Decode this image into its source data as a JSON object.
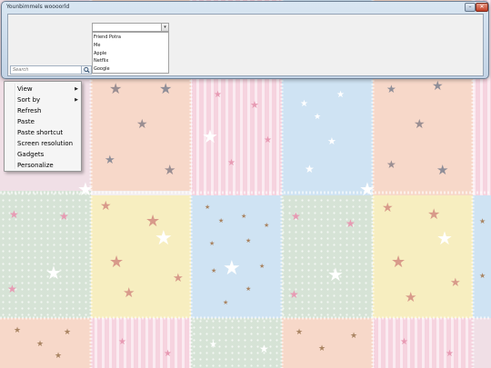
{
  "window": {
    "title": "Younbimmels woooorld",
    "minimize_glyph": "–",
    "close_glyph": "✕"
  },
  "combo": {
    "value": "",
    "arrow_glyph": "▾",
    "items": [
      "Friend Potra",
      "Me",
      "Apple",
      "Netflix",
      "Google"
    ]
  },
  "search": {
    "placeholder": "Search",
    "icon": "magnifier-icon"
  },
  "context_menu": {
    "items": [
      {
        "label": "View",
        "has_submenu": true
      },
      {
        "label": "Sort by",
        "has_submenu": true
      },
      {
        "label": "Refresh",
        "has_submenu": false
      },
      {
        "label": "Paste",
        "has_submenu": false
      },
      {
        "label": "Paste shortcut",
        "has_submenu": false
      },
      {
        "label": "Screen resolution",
        "has_submenu": false
      },
      {
        "label": "Gadgets",
        "has_submenu": false
      },
      {
        "label": "Personalize",
        "has_submenu": false
      }
    ],
    "submenu_arrow": "▶"
  },
  "wallpaper": {
    "description_icon": "quilt-stars-wallpaper",
    "colors": {
      "pink": "#f6d3df",
      "peach": "#f7d8c9",
      "blue": "#cfe3f3",
      "green": "#d6e3d6",
      "yellow": "#f7eec0",
      "lavender": "#e6dff0",
      "star_pink": "#e79ab3",
      "star_brown": "#a98462",
      "star_gray": "#8f8e98",
      "star_white": "#ffffff",
      "seam": "#ffffff"
    }
  }
}
